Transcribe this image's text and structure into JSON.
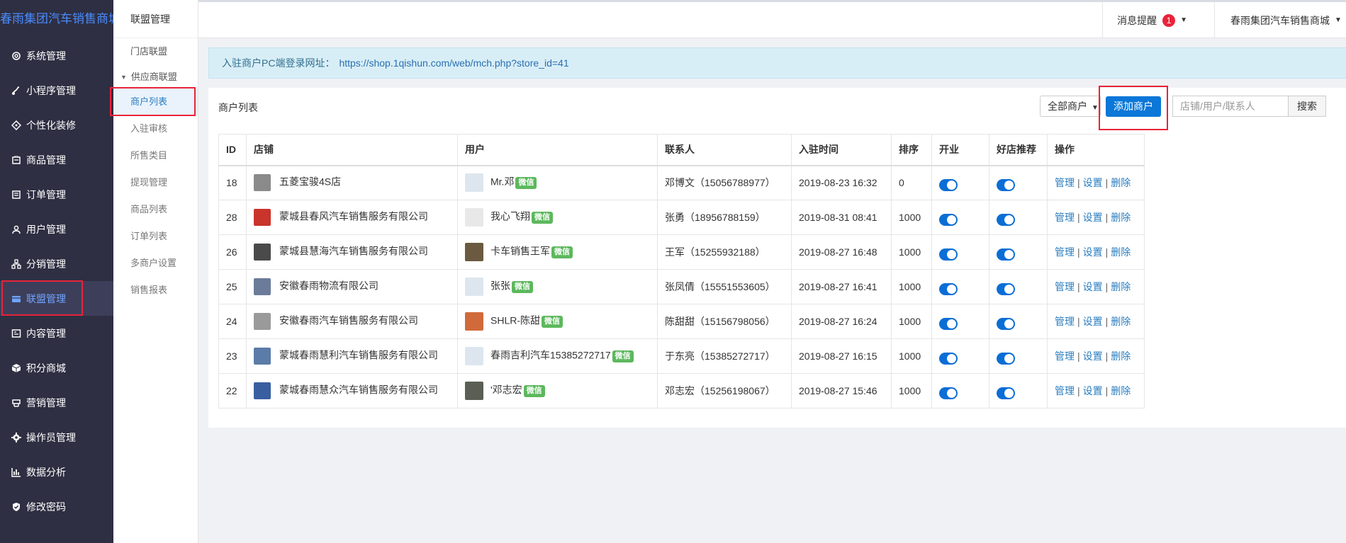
{
  "brand": "春雨集团汽车销售商城",
  "sidebar": {
    "items": [
      {
        "label": "系统管理",
        "icon": "gear"
      },
      {
        "label": "小程序管理",
        "icon": "miniapp"
      },
      {
        "label": "个性化装修",
        "icon": "decor"
      },
      {
        "label": "商品管理",
        "icon": "goods"
      },
      {
        "label": "订单管理",
        "icon": "order"
      },
      {
        "label": "用户管理",
        "icon": "user"
      },
      {
        "label": "分销管理",
        "icon": "distribution"
      },
      {
        "label": "联盟管理",
        "icon": "store",
        "active": true
      },
      {
        "label": "内容管理",
        "icon": "content"
      },
      {
        "label": "积分商城",
        "icon": "points"
      },
      {
        "label": "营销管理",
        "icon": "marketing"
      },
      {
        "label": "操作员管理",
        "icon": "operator"
      },
      {
        "label": "数据分析",
        "icon": "chart"
      },
      {
        "label": "修改密码",
        "icon": "shield"
      }
    ]
  },
  "subnav": {
    "title": "联盟管理",
    "store_alliance": "门店联盟",
    "group": "供应商联盟",
    "children": [
      "商户列表",
      "入驻审核",
      "所售类目",
      "提现管理",
      "商品列表",
      "订单列表",
      "多商户设置",
      "销售报表"
    ]
  },
  "topbar": {
    "message_label": "消息提醒",
    "message_count": "1",
    "user_name": "春雨集团汽车销售商城"
  },
  "alert": {
    "label": "入驻商户PC端登录网址：",
    "url": "https://shop.1qishun.com/web/mch.php?store_id=41"
  },
  "panel": {
    "title": "商户列表",
    "filter_label": "全部商户",
    "add_label": "添加商户",
    "search_placeholder": "店铺/用户/联系人",
    "search_label": "搜索"
  },
  "table": {
    "headers": [
      "ID",
      "店铺",
      "用户",
      "联系人",
      "入驻时间",
      "排序",
      "开业",
      "好店推荐",
      "操作"
    ],
    "wechat_tag": "微信",
    "actions": [
      "管理",
      "设置",
      "删除"
    ],
    "rows": [
      {
        "id": "18",
        "store": "五菱宝骏4S店",
        "user": "Mr.邓",
        "contact": "邓博文（15056788977）",
        "time": "2019-08-23 16:32",
        "sort": "0",
        "open": true,
        "recommend": true
      },
      {
        "id": "28",
        "store": "蒙城县春风汽车销售服务有限公司",
        "user": "我心飞翔",
        "contact": "张勇（18956788159）",
        "time": "2019-08-31 08:41",
        "sort": "1000",
        "open": true,
        "recommend": true
      },
      {
        "id": "26",
        "store": "蒙城县慧海汽车销售服务有限公司",
        "user": "卡车销售王军",
        "contact": "王军（15255932188）",
        "time": "2019-08-27 16:48",
        "sort": "1000",
        "open": true,
        "recommend": true
      },
      {
        "id": "25",
        "store": "安徽春雨物流有限公司",
        "user": "张张",
        "contact": "张凤倩（15551553605）",
        "time": "2019-08-27 16:41",
        "sort": "1000",
        "open": true,
        "recommend": true
      },
      {
        "id": "24",
        "store": "安徽春雨汽车销售服务有限公司",
        "user": "SHLR-陈甜",
        "contact": "陈甜甜（15156798056）",
        "time": "2019-08-27 16:24",
        "sort": "1000",
        "open": true,
        "recommend": true
      },
      {
        "id": "23",
        "store": "蒙城春雨慧利汽车销售服务有限公司",
        "user": "春雨吉利汽车15385272717",
        "contact": "于东亮（15385272717）",
        "time": "2019-08-27 16:15",
        "sort": "1000",
        "open": true,
        "recommend": true
      },
      {
        "id": "22",
        "store": "蒙城春雨慧众汽车销售服务有限公司",
        "user": "'邓志宏",
        "contact": "邓志宏（15256198067）",
        "time": "2019-08-27 15:46",
        "sort": "1000",
        "open": true,
        "recommend": true
      }
    ]
  }
}
